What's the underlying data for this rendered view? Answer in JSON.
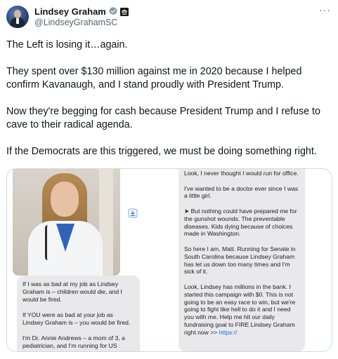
{
  "author": {
    "name": "Lindsey Graham",
    "handle": "@LindseyGrahamSC",
    "verified_icon": "verified-badge-icon",
    "affiliation_icon": "government-badge-icon"
  },
  "more_label": "···",
  "tweet": {
    "paragraphs": [
      "The Left is losing it…again.",
      "They spent over $130 million against me in 2020 because I helped confirm Kavanaugh, and I stand proudly with President Trump.",
      "Now they're begging for cash because President Trump and I refuse to cave to their radical agenda.",
      "If the Democrats are this triggered, we must be doing something right."
    ]
  },
  "media": {
    "left_messages": [
      "If I was as bad at my job as Lindsey Graham is – children would die, and I would be fired.",
      "If YOU were as bad at your job as Lindsey Graham is – you would be fired.",
      "I'm Dr. Annie Andrews – a mom of 3, a pediatrician, and I'm running for US"
    ],
    "right_messages": [
      "Look, I never thought I would run for office.",
      "I've wanted to be a doctor ever since I was a little girl.",
      "➤ But nothing could have prepared me for the gunshot wounds. The preventable diseases. Kids dying because of choices made in Washington.",
      "So here I am, Matt. Running for Senate in South Carolina because Lindsey Graham has let us down too many times and I'm sick of it."
    ],
    "right_last_message": "Look, Lindsey has millions in the bank. I started this campaign with $0. This is not going to be an easy race to win, but we're going to fight like hell to do it and I need you with me. Help me hit our daily fundraising goal to FIRE Lindsey Graham right now >> ",
    "right_last_link": "https://"
  },
  "colors": {
    "text": "#0f1419",
    "secondary": "#536471",
    "verified": "#829aab",
    "link": "#1b6fe0",
    "bubble": "#e9e9eb"
  }
}
